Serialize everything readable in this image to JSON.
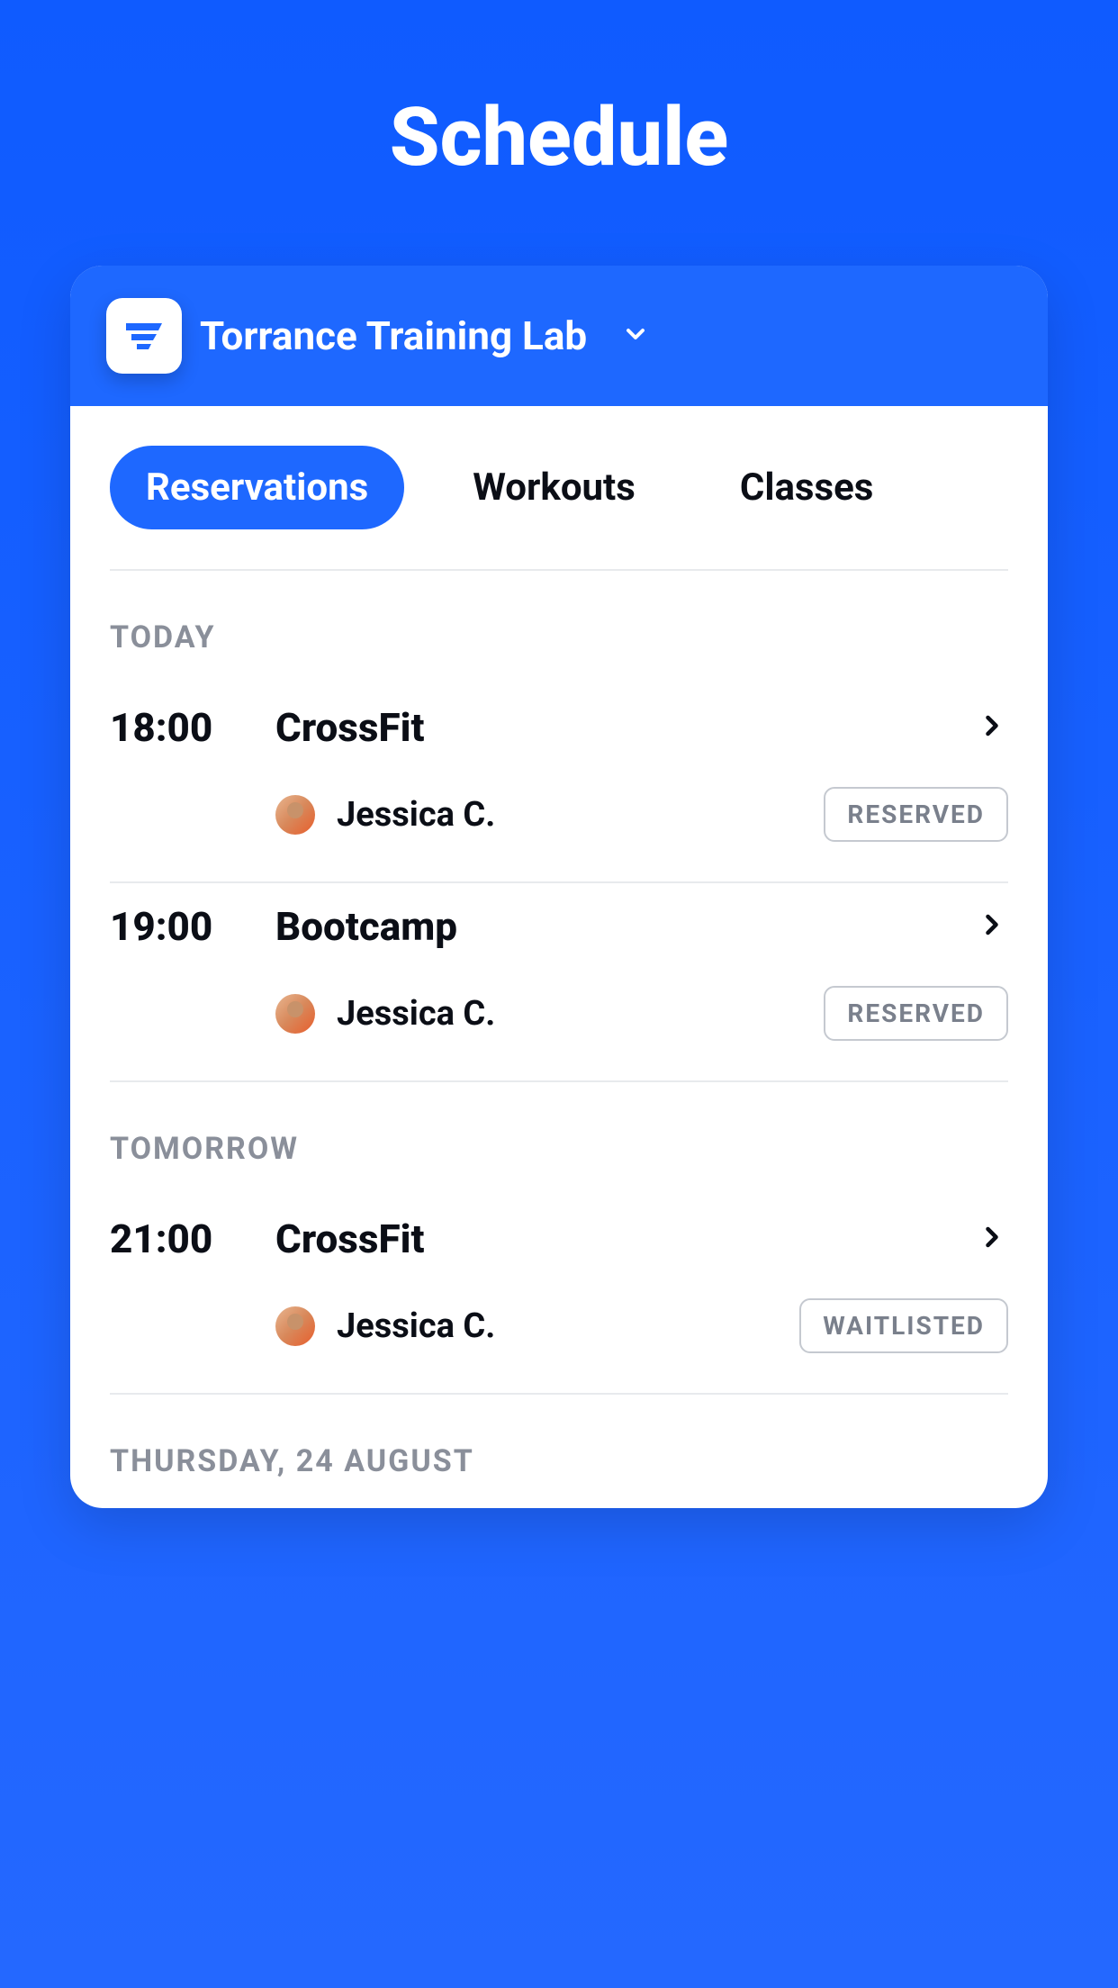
{
  "title": "Schedule",
  "header": {
    "location_name": "Torrance Training Lab"
  },
  "tabs": {
    "reservations": "Reservations",
    "workouts": "Workouts",
    "classes": "Classes"
  },
  "sections": [
    {
      "label": "TODAY",
      "items": [
        {
          "time": "18:00",
          "name": "CrossFit",
          "instructor": "Jessica C.",
          "status": "RESERVED"
        },
        {
          "time": "19:00",
          "name": "Bootcamp",
          "instructor": "Jessica C.",
          "status": "RESERVED"
        }
      ]
    },
    {
      "label": "TOMORROW",
      "items": [
        {
          "time": "21:00",
          "name": "CrossFit",
          "instructor": "Jessica C.",
          "status": "WAITLISTED"
        }
      ]
    },
    {
      "label": "THURSDAY, 24 AUGUST",
      "items": []
    }
  ]
}
